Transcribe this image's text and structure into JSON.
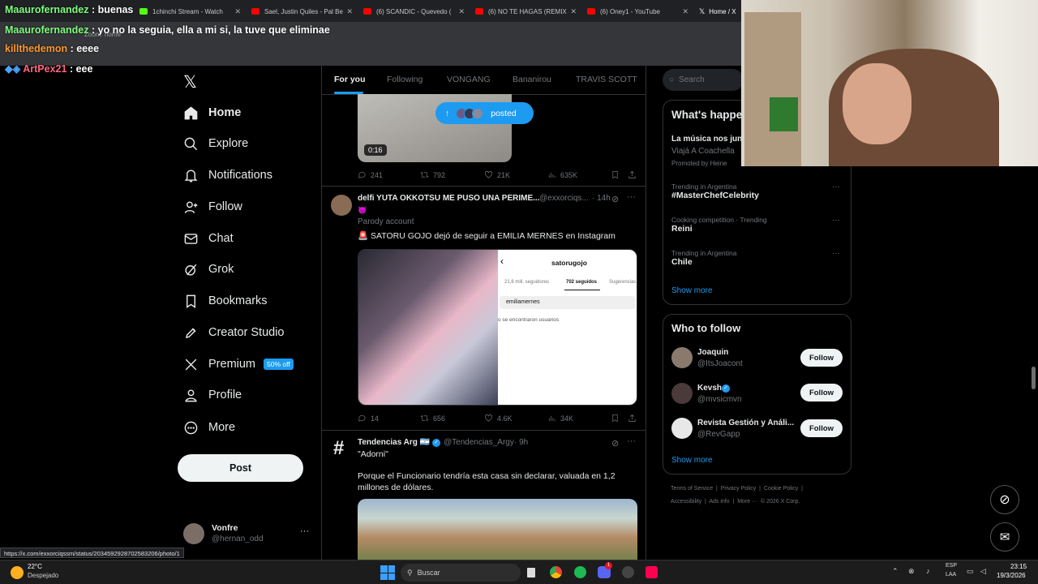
{
  "browser": {
    "tabs": [
      {
        "label": "1chinchi Stream - Watch",
        "color": "#53fc18"
      },
      {
        "label": "Sael, Justin Quiles - Pal Be",
        "color": "#ff0000"
      },
      {
        "label": "(6) SCANDIC - Quevedo (",
        "color": "#ff0000"
      },
      {
        "label": "(6) NO TE HAGAS (REMIX",
        "color": "#ff0000"
      },
      {
        "label": "(6) Oney1 - YouTube",
        "color": "#ff0000"
      },
      {
        "label": "Home / X",
        "color": "#ffffff"
      }
    ],
    "zoom_text": "Zoom: home"
  },
  "chat": [
    {
      "user": "Maaurofernandez",
      "text": ": buenas"
    },
    {
      "user": "Maaurofernandez",
      "text": ": yo no la seguia, ella a mi si, la tuve que eliminae"
    },
    {
      "user": "killthedemon",
      "text": ": eeee"
    },
    {
      "user": "ArtPex21",
      "text": ": eee"
    }
  ],
  "nav": {
    "home": "Home",
    "explore": "Explore",
    "notifications": "Notifications",
    "follow": "Follow",
    "chat": "Chat",
    "grok": "Grok",
    "bookmarks": "Bookmarks",
    "creator": "Creator Studio",
    "premium": "Premium",
    "premium_badge": "50% off",
    "profile": "Profile",
    "more": "More",
    "post": "Post"
  },
  "account": {
    "name": "Vonfre",
    "handle": "@hernan_odd"
  },
  "feed_tabs": [
    "For you",
    "Following",
    "VONGANG",
    "Bananirou",
    "TRAVIS SCOTT"
  ],
  "posted_pill": "posted",
  "tweet0": {
    "duration": "0:16",
    "replies": "241",
    "reposts": "792",
    "likes": "21K",
    "views": "635K"
  },
  "tweet1": {
    "name": "delfi YUTA OKKOTSU ME PUSO UNA PERIME...",
    "handle": "@exxorciqs...",
    "time": "· 14h",
    "emoji": "😈",
    "parody": "Parody account",
    "text": "🚨 SATORU GOJO dejó de seguir a EMILIA MERNES en Instagram",
    "ig_user": "satorugojo",
    "ig_tab1": "21,6 mill. seguidores",
    "ig_tab2": "702 seguidos",
    "ig_tab3": "Sugerencias",
    "ig_search": "emiliamernes",
    "ig_empty": "o se encontraron usuarios",
    "replies": "14",
    "reposts": "656",
    "likes": "4.6K",
    "views": "34K"
  },
  "tweet2": {
    "name": "Tendencias Arg 🇦🇷",
    "handle": "@Tendencias_Argy",
    "time": "· 9h",
    "line1": "\"Adorni\"",
    "line2": "Porque el Funcionario tendría esta casa sin declarar, valuada en 1,2",
    "line3": "millones de dólares."
  },
  "search_placeholder": "Search",
  "whats": {
    "title": "What's happe",
    "promo_title": "La música nos junt",
    "promo_sub": "Viajá A Coachella",
    "promo_by": "Promoted by Heine",
    "trends": [
      {
        "sub": "Trending in Argentina",
        "name": "#MasterChefCelebrity"
      },
      {
        "sub": "Cooking competition · Trending",
        "name": "Reini"
      },
      {
        "sub": "Trending in Argentina",
        "name": "Chile"
      }
    ],
    "show_more": "Show more"
  },
  "who": {
    "title": "Who to follow",
    "users": [
      {
        "name": "Joaquin",
        "handle": "@ItsJoacont"
      },
      {
        "name": "Kevsh",
        "handle": "@mvsicmvn"
      },
      {
        "name": "Revista Gestión y Análi...",
        "handle": "@RevGapp"
      }
    ],
    "follow_label": "Follow",
    "show_more": "Show more"
  },
  "footer": {
    "line1": "Terms of Service  |  Privacy Policy  |  Cookie Policy  |",
    "line2": "Accessibility  |  Ads info  |  More ···  © 2026 X Corp."
  },
  "status_url": "https://x.com/exxorciqssm/status/2034592928702583206/photo/1",
  "taskbar": {
    "temp": "22°C",
    "weather": "Despejado",
    "search": "Buscar",
    "lang1": "ESP",
    "lang2": "LAA",
    "time": "23:15",
    "date": "19/3/2026",
    "badge": "1"
  }
}
